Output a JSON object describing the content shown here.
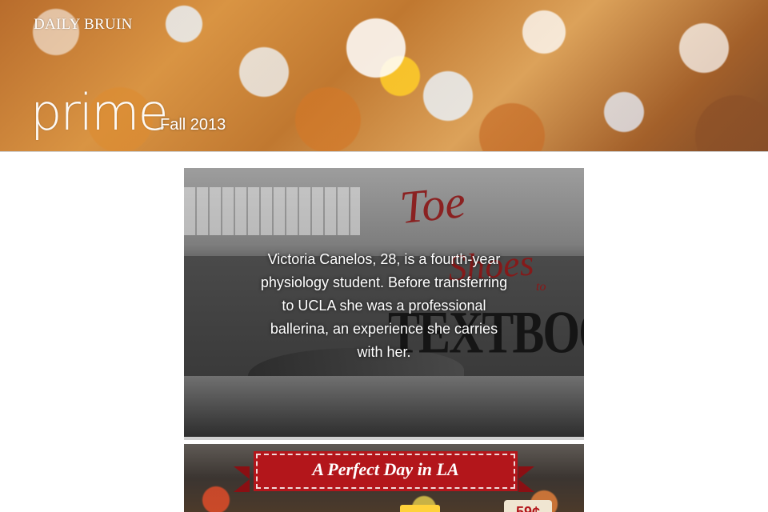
{
  "header": {
    "masthead": "DAILY BRUIN",
    "publication": "prime",
    "issue": "Fall 2013"
  },
  "stories": [
    {
      "title_script_1": "Toe",
      "title_script_2": "Shoes",
      "title_to": "to",
      "title_block": "TEXTBOOKS",
      "caption": "Victoria Canelos, 28, is a fourth-year physiology student. Before transferring to UCLA she was a professional ballerina, an experience she carries with her."
    },
    {
      "title": "A Perfect Day in LA",
      "price_text": "59¢"
    }
  ],
  "colors": {
    "accent_red": "#b3161b",
    "title_red": "#8b1616"
  },
  "icons": []
}
